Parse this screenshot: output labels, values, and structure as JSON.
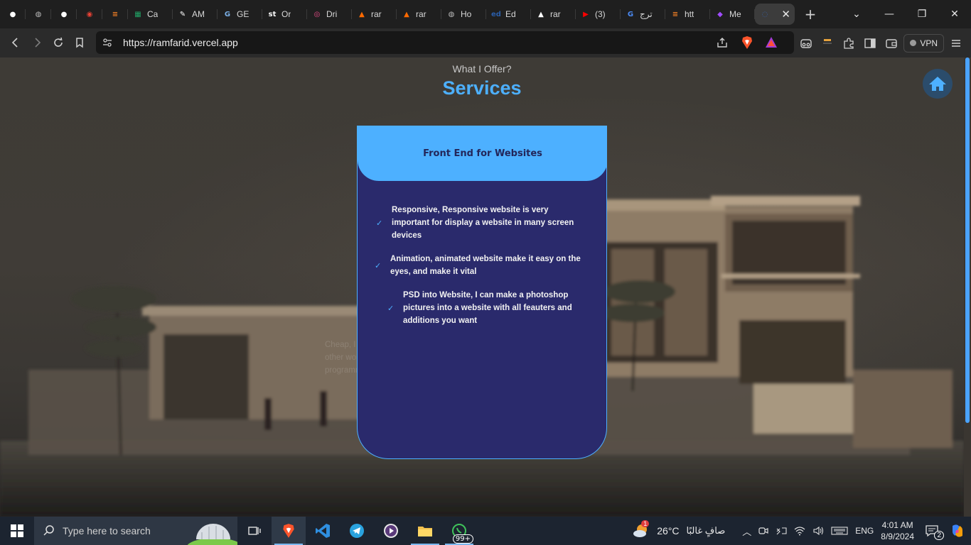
{
  "browser": {
    "tabs": [
      {
        "title": "",
        "icon": "github-icon",
        "color": "#ffffff",
        "pinned": true
      },
      {
        "title": "",
        "icon": "globe-icon",
        "color": "#bdbdbd",
        "pinned": true
      },
      {
        "title": "",
        "icon": "github-icon",
        "color": "#ffffff",
        "pinned": true
      },
      {
        "title": "",
        "icon": "chrome-icon",
        "color": "#e94235",
        "pinned": true
      },
      {
        "title": "",
        "icon": "stackoverflow-icon",
        "color": "#f48024",
        "pinned": true
      },
      {
        "title": "Ca",
        "icon": "sheets-icon",
        "color": "#21a366",
        "pinned": false
      },
      {
        "title": "AM",
        "icon": "pen-icon",
        "color": "#ffffff",
        "pinned": false
      },
      {
        "title": "GE",
        "icon": "get-icon",
        "color": "#7bb1e8",
        "pinned": false
      },
      {
        "title": "Or",
        "icon": "st-icon",
        "color": "#ffffff",
        "pinned": false
      },
      {
        "title": "Dri",
        "icon": "dribbble-icon",
        "color": "#ea4c89",
        "pinned": false
      },
      {
        "title": "rar",
        "icon": "fire-icon",
        "color": "#ff6a00",
        "pinned": false
      },
      {
        "title": "rar",
        "icon": "fire-icon",
        "color": "#ff6a00",
        "pinned": false
      },
      {
        "title": "Ho",
        "icon": "globe-icon",
        "color": "#bdbdbd",
        "pinned": false
      },
      {
        "title": "Ed",
        "icon": "edx-icon",
        "color": "#2a5da8",
        "pinned": false
      },
      {
        "title": "rar",
        "icon": "vercel-icon",
        "color": "#ffffff",
        "pinned": false
      },
      {
        "title": "(3)",
        "icon": "youtube-icon",
        "color": "#ff0000",
        "pinned": false
      },
      {
        "title": "ترج",
        "icon": "translate-icon",
        "color": "#4a8af4",
        "pinned": false
      },
      {
        "title": "htt",
        "icon": "stackoverflow-icon",
        "color": "#f48024",
        "pinned": false
      },
      {
        "title": "Me",
        "icon": "messenger-icon",
        "color": "#a04cff",
        "pinned": false
      }
    ],
    "active_tab": {
      "icon": "loading-icon",
      "color": "#3a5ea0"
    },
    "url": "https://ramfarid.vercel.app",
    "vpn_label": "VPN"
  },
  "page": {
    "subtitle": "What I Offer?",
    "title": "Services",
    "accent_color": "#4db0ff",
    "card": {
      "heading": "Front End for Websites",
      "features": [
        "Responsive, Responsive website is very important for display a website in many screen devices",
        "Animation, animated website make it easy on the eyes, and make it vital",
        "PSD into Website, I can make a photoshop pictures into a website with all feauters and additions you want"
      ],
      "faded_text": "Cheap, I offer you the cheapest price compared to other workers because I do not want money but programming"
    }
  },
  "taskbar": {
    "search_placeholder": "Type here to search",
    "weather_temp": "26°C",
    "weather_desc": "صافٍ غالبًا",
    "weather_badge": "1",
    "language": "ENG",
    "time": "4:01 AM",
    "date": "8/9/2024",
    "whatsapp_badge": "99+",
    "notification_count": "2"
  }
}
